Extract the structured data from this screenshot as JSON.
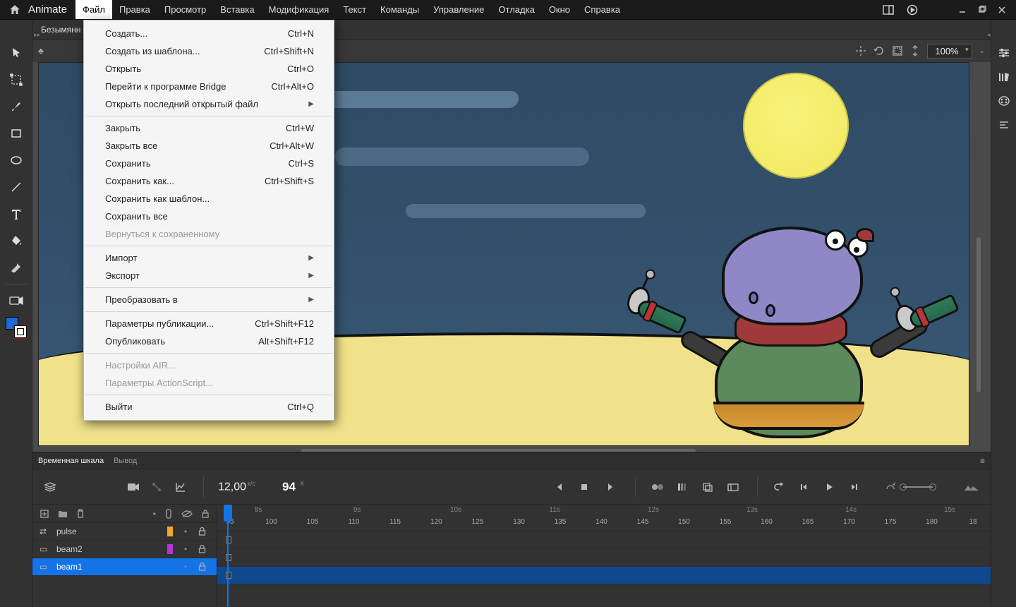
{
  "app": {
    "title": "Animate"
  },
  "menubar": [
    "Файл",
    "Правка",
    "Просмотр",
    "Вставка",
    "Модификация",
    "Текст",
    "Команды",
    "Управление",
    "Отладка",
    "Окно",
    "Справка"
  ],
  "active_menu_index": 0,
  "doc_tab": "Безымянн",
  "file_menu": [
    {
      "label": "Создать...",
      "shortcut": "Ctrl+N"
    },
    {
      "label": "Создать из шаблона...",
      "shortcut": "Ctrl+Shift+N"
    },
    {
      "label": "Открыть",
      "shortcut": "Ctrl+O"
    },
    {
      "label": "Перейти к программе Bridge",
      "shortcut": "Ctrl+Alt+O"
    },
    {
      "label": "Открыть последний открытый файл",
      "submenu": true
    },
    {
      "sep": true
    },
    {
      "label": "Закрыть",
      "shortcut": "Ctrl+W"
    },
    {
      "label": "Закрыть все",
      "shortcut": "Ctrl+Alt+W"
    },
    {
      "label": "Сохранить",
      "shortcut": "Ctrl+S"
    },
    {
      "label": "Сохранить как...",
      "shortcut": "Ctrl+Shift+S"
    },
    {
      "label": "Сохранить как шаблон..."
    },
    {
      "label": "Сохранить все"
    },
    {
      "label": "Вернуться к сохраненному",
      "disabled": true
    },
    {
      "sep": true
    },
    {
      "label": "Импорт",
      "submenu": true
    },
    {
      "label": "Экспорт",
      "submenu": true
    },
    {
      "sep": true
    },
    {
      "label": "Преобразовать в",
      "submenu": true
    },
    {
      "sep": true
    },
    {
      "label": "Параметры публикации...",
      "shortcut": "Ctrl+Shift+F12"
    },
    {
      "label": "Опубликовать",
      "shortcut": "Alt+Shift+F12"
    },
    {
      "sep": true
    },
    {
      "label": "Настройки AIR...",
      "disabled": true
    },
    {
      "label": "Параметры ActionScript...",
      "disabled": true
    },
    {
      "sep": true
    },
    {
      "label": "Выйти",
      "shortcut": "Ctrl+Q"
    }
  ],
  "zoom": "100%",
  "timeline": {
    "tabs": {
      "active": "Временная шкала",
      "other": "Вывод"
    },
    "fps": "12,00",
    "fps_unit": "к/с",
    "frame": "94",
    "frame_unit": "К",
    "seconds": [
      "8s",
      "9s",
      "10s",
      "11s",
      "12s",
      "13s",
      "14s",
      "15s"
    ],
    "frames": [
      "95",
      "100",
      "105",
      "110",
      "115",
      "120",
      "125",
      "130",
      "135",
      "140",
      "145",
      "150",
      "155",
      "160",
      "165",
      "170",
      "175",
      "180",
      "18"
    ],
    "layers": [
      {
        "name": "pulse",
        "type": "tween",
        "color": "#f5a623",
        "locked": true
      },
      {
        "name": "beam2",
        "type": "layer",
        "color": "#b038d6",
        "locked": true
      },
      {
        "name": "beam1",
        "type": "layer",
        "color": "#1473e6",
        "locked": true,
        "selected": true
      }
    ]
  }
}
